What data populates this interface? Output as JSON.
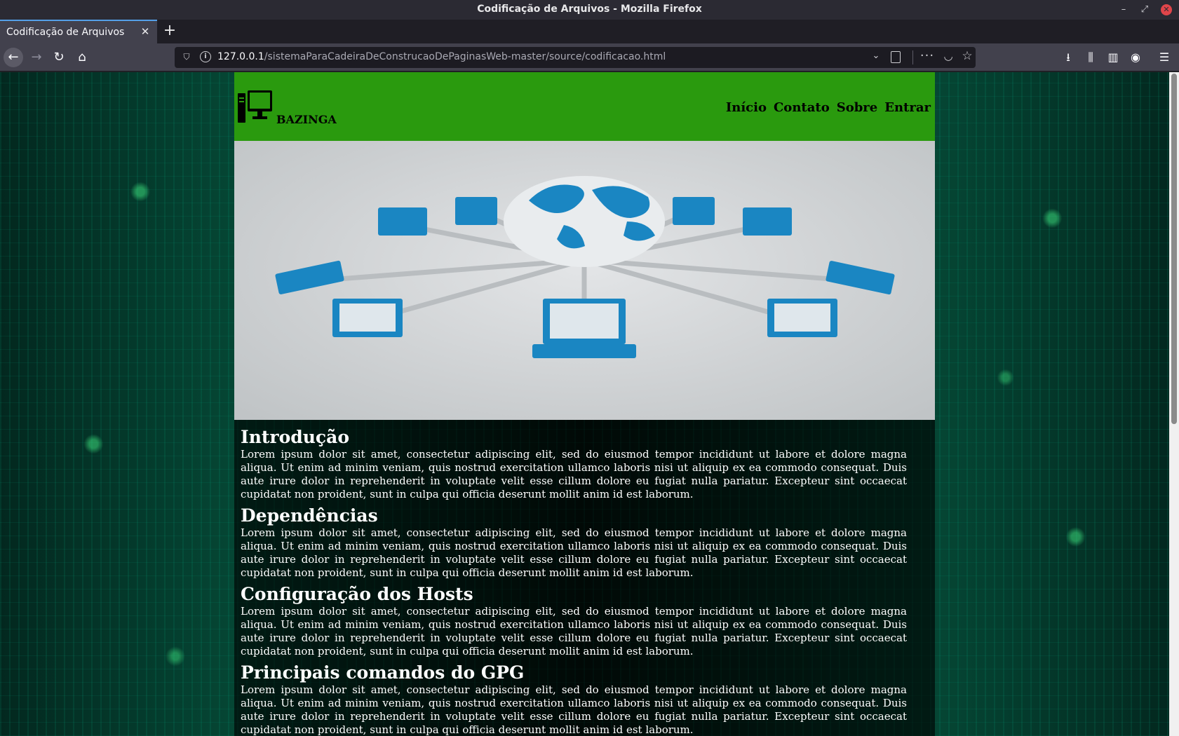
{
  "window": {
    "title": "Codificação de Arquivos - Mozilla Firefox"
  },
  "tab": {
    "label": "Codificação de Arquivos"
  },
  "urlbar": {
    "host": "127.0.0.1",
    "path": "/sistemaParaCadeiraDeConstrucaoDePaginasWeb-master/source/codificacao.html"
  },
  "site": {
    "brand": "BAZINGA",
    "nav": [
      "Início",
      "Contato",
      "Sobre",
      "Entrar"
    ],
    "colors": {
      "header": "#2a9a0e",
      "hero_globe": "#1a86c2"
    }
  },
  "sections": [
    {
      "heading": "Introdução",
      "body": "Lorem ipsum dolor sit amet, consectetur adipiscing elit, sed do eiusmod tempor incididunt ut labore et dolore magna aliqua. Ut enim ad minim veniam, quis nostrud exercitation ullamco laboris nisi ut aliquip ex ea commodo consequat. Duis aute irure dolor in reprehenderit in voluptate velit esse cillum dolore eu fugiat nulla pariatur. Excepteur sint occaecat cupidatat non proident, sunt in culpa qui officia deserunt mollit anim id est laborum."
    },
    {
      "heading": "Dependências",
      "body": "Lorem ipsum dolor sit amet, consectetur adipiscing elit, sed do eiusmod tempor incididunt ut labore et dolore magna aliqua. Ut enim ad minim veniam, quis nostrud exercitation ullamco laboris nisi ut aliquip ex ea commodo consequat. Duis aute irure dolor in reprehenderit in voluptate velit esse cillum dolore eu fugiat nulla pariatur. Excepteur sint occaecat cupidatat non proident, sunt in culpa qui officia deserunt mollit anim id est laborum."
    },
    {
      "heading": "Configuração dos Hosts",
      "body": "Lorem ipsum dolor sit amet, consectetur adipiscing elit, sed do eiusmod tempor incididunt ut labore et dolore magna aliqua. Ut enim ad minim veniam, quis nostrud exercitation ullamco laboris nisi ut aliquip ex ea commodo consequat. Duis aute irure dolor in reprehenderit in voluptate velit esse cillum dolore eu fugiat nulla pariatur. Excepteur sint occaecat cupidatat non proident, sunt in culpa qui officia deserunt mollit anim id est laborum."
    },
    {
      "heading": "Principais comandos do GPG",
      "body": "Lorem ipsum dolor sit amet, consectetur adipiscing elit, sed do eiusmod tempor incididunt ut labore et dolore magna aliqua. Ut enim ad minim veniam, quis nostrud exercitation ullamco laboris nisi ut aliquip ex ea commodo consequat. Duis aute irure dolor in reprehenderit in voluptate velit esse cillum dolore eu fugiat nulla pariatur. Excepteur sint occaecat cupidatat non proident, sunt in culpa qui officia deserunt mollit anim id est laborum."
    }
  ],
  "icons": [
    "shield-icon",
    "info-icon",
    "chevron-down-icon",
    "reader-view-icon",
    "more-icon",
    "pocket-icon",
    "star-icon",
    "download-icon",
    "library-icon",
    "sidebar-icon",
    "account-icon",
    "menu-icon",
    "computer-icon",
    "globe-network-icon"
  ]
}
